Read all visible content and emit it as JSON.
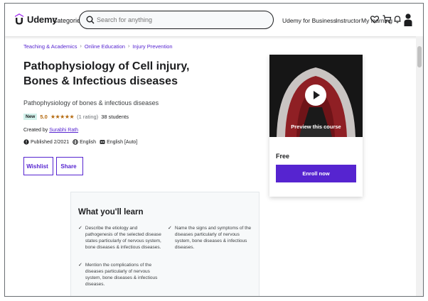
{
  "header": {
    "logo_text": "Udemy",
    "categories_label": "Categories",
    "search_placeholder": "Search for anything",
    "business_label": "Udemy for Business",
    "instructor_label": "Instructor",
    "my_learning_label": "My learning",
    "icons": [
      "heart-icon",
      "cart-icon",
      "bell-icon",
      "avatar"
    ]
  },
  "breadcrumb": [
    "Teaching & Academics",
    "Online Education",
    "Injury Prevention"
  ],
  "course": {
    "title": "Pathophysiology of Cell injury, Bones & Infectious diseases",
    "subtitle": "Pathophysiology of bones & infectious diseases",
    "badge": "New",
    "rating": "5.0",
    "stars": "★★★★★",
    "rating_count": "(1 rating)",
    "students": "38 students",
    "created_by_label": "Created by",
    "instructor": "Surabhi Rath",
    "published": "Published 2/2021",
    "language": "English",
    "captions": "English [Auto]"
  },
  "actions": {
    "wishlist_label": "Wishlist",
    "share_label": "Share"
  },
  "sidebar_card": {
    "preview_label": "Preview this course",
    "price": "Free",
    "enroll_label": "Enroll now"
  },
  "learn": {
    "title": "What you'll learn",
    "items": [
      "Describe the etiology and pathogenesis of the selected disease states particularly of nervous system, bone diseases & infectious diseases.",
      "Name the signs and symptoms of the diseases particularly of nervous system, bone diseases & infectious diseases.",
      "Mention the complications of the diseases particularly of nervous system, bone diseases & infectious diseases."
    ]
  },
  "colors": {
    "brand": "#5624d0",
    "rating": "#b4690e",
    "badge_bg": "#d1f0ea",
    "text": "#1c1d1f"
  }
}
